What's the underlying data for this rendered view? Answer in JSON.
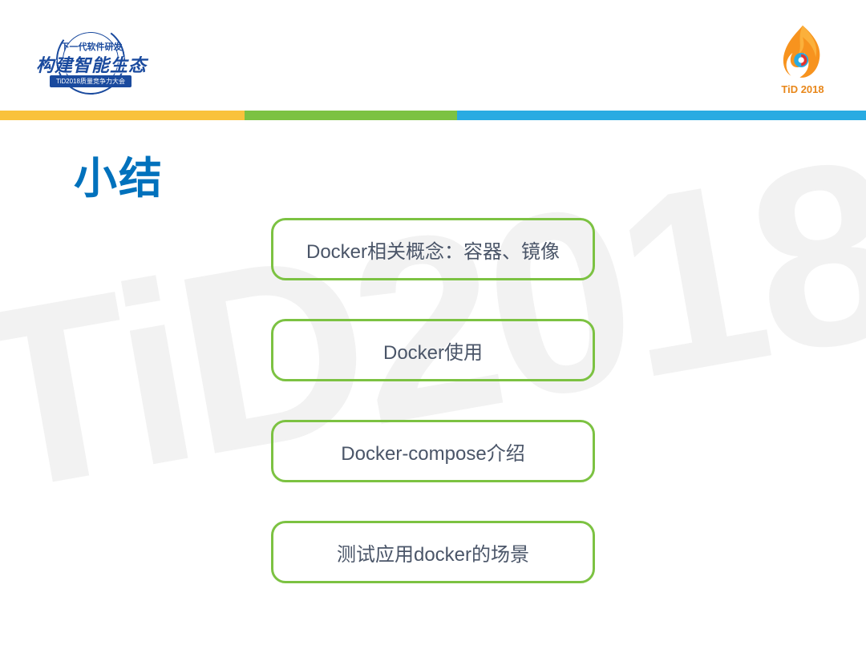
{
  "watermark": "TiD2018",
  "header": {
    "left_logo": {
      "sub_text": "下一代软件研发",
      "main_text": "构建智能生态",
      "tag_text": "TiD2018质量竞争力大会"
    },
    "right_logo": {
      "label": "TiD 2018"
    }
  },
  "title": "小结",
  "boxes": [
    {
      "text": "Docker相关概念：容器、镜像"
    },
    {
      "text": "Docker使用"
    },
    {
      "text": "Docker-compose介绍"
    },
    {
      "text": "测试应用docker的场景"
    }
  ]
}
